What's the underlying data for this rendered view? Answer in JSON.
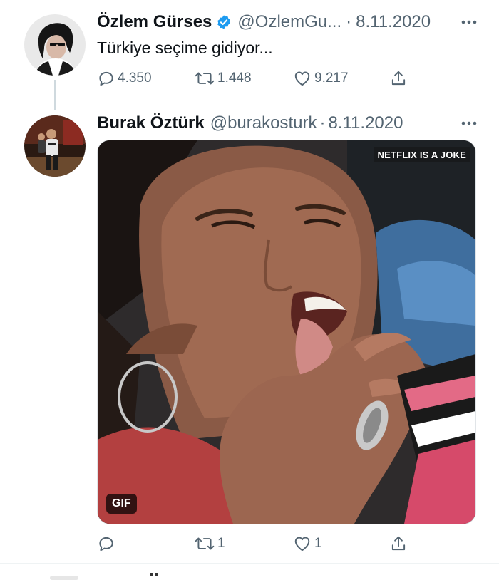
{
  "tweets": [
    {
      "name": "Özlem Gürses",
      "verified": true,
      "handle": "@OzlemGu...",
      "date": "8.11.2020",
      "text": "Türkiye seçime gidiyor...",
      "replies": "4.350",
      "retweets": "1.448",
      "likes": "9.217"
    },
    {
      "name": "Burak Öztürk",
      "verified": false,
      "handle": "@burakosturk",
      "date": "8.11.2020",
      "media": {
        "watermark": "NETFLIX IS A JOKE",
        "badge": "GIF"
      },
      "replies": "",
      "retweets": "1",
      "likes": "1"
    }
  ],
  "icons": {
    "verified": "verified-badge-icon",
    "more": "more-dots-icon",
    "reply": "reply-icon",
    "retweet": "retweet-icon",
    "like": "heart-icon",
    "share": "share-icon"
  },
  "colors": {
    "text": "#0f1419",
    "secondary": "#536471",
    "verified": "#1d9bf0",
    "thread_line": "#cfd9de"
  },
  "separator": "·"
}
